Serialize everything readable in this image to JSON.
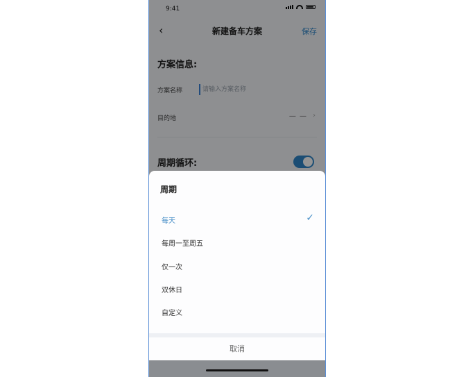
{
  "status_bar": {
    "time": "9:41"
  },
  "navbar": {
    "back_icon": "chevron-left-icon",
    "title": "新建备车方案",
    "save_label": "保存"
  },
  "form": {
    "plan_section_title": "方案信息:",
    "plan_name_label": "方案名称",
    "plan_name_placeholder": "请输入方案名称",
    "destination_label": "目的地",
    "destination_value": "— —",
    "cycle_section_title": "周期循环:",
    "cycle_toggle_on": true
  },
  "sheet": {
    "title": "周期",
    "options": [
      {
        "label": "每天",
        "selected": true
      },
      {
        "label": "每周一至周五",
        "selected": false
      },
      {
        "label": "仅一次",
        "selected": false
      },
      {
        "label": "双休日",
        "selected": false
      },
      {
        "label": "自定义",
        "selected": false
      }
    ],
    "cancel_label": "取消"
  },
  "colors": {
    "accent": "#2f86c9",
    "selected_text": "#4a90c8"
  }
}
